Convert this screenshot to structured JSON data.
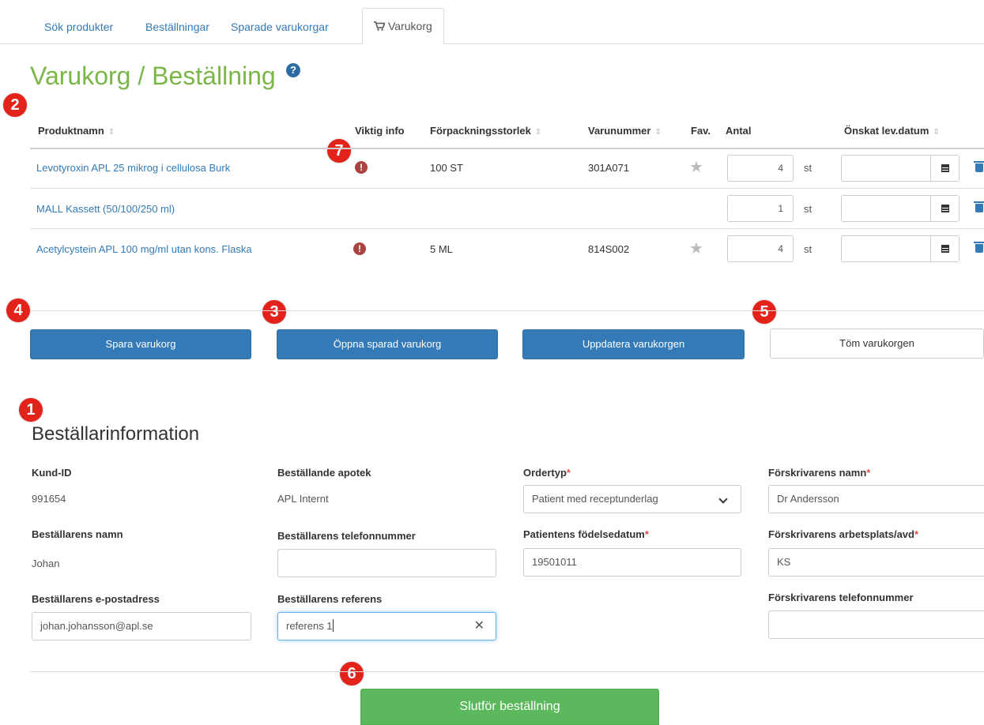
{
  "tabs": [
    {
      "label": "Sök produkter"
    },
    {
      "label": "Beställningar"
    },
    {
      "label": "Sparade varukorgar"
    },
    {
      "label": "Varukorg",
      "icon": "cart-icon",
      "active": true
    }
  ],
  "page": {
    "title": "Varukorg / Beställning",
    "help_icon": "question-circle-icon"
  },
  "annotations": [
    "1",
    "2",
    "3",
    "4",
    "5",
    "6",
    "7"
  ],
  "colors": {
    "brand_green": "#7ab648",
    "primary": "#337ab7",
    "success": "#5cb85c",
    "badge_red": "#e3221a",
    "warning": "#a94442"
  },
  "cart": {
    "columns": {
      "product": "Produktnamn",
      "info": "Viktig info",
      "pack": "Förpackningsstorlek",
      "article": "Varunummer",
      "fav": "Fav.",
      "qty": "Antal",
      "date": "Önskat lev.datum"
    },
    "sort_icon": "sort-icon",
    "rows": [
      {
        "name": "Levotyroxin APL 25 mikrog i cellulosa Burk",
        "info": "exclamation-circle-icon",
        "pack": "100 ST",
        "article": "301A071",
        "fav": "star-icon",
        "qty": "4",
        "unit": "st",
        "date": ""
      },
      {
        "name": "MALL Kassett (50/100/250 ml)",
        "info": "",
        "pack": "",
        "article": "",
        "fav": "",
        "qty": "1",
        "unit": "st",
        "date": ""
      },
      {
        "name": "Acetylcystein APL 100 mg/ml utan kons. Flaska",
        "info": "exclamation-circle-icon",
        "pack": "5 ML",
        "article": "814S002",
        "fav": "star-icon",
        "qty": "4",
        "unit": "st",
        "date": ""
      }
    ]
  },
  "actions": {
    "save": "Spara varukorg",
    "open": "Öppna sparad varukorg",
    "update": "Uppdatera varukorgen",
    "empty": "Töm varukorgen"
  },
  "orderer": {
    "title": "Beställarinformation",
    "customer_id_label": "Kund-ID",
    "customer_id": "991654",
    "pharmacy_label": "Beställande apotek",
    "pharmacy": "APL Internt",
    "order_type_label": "Ordertyp",
    "order_type": "Patient med receptunderlag",
    "prescriber_name_label": "Förskrivarens namn",
    "prescriber_name": "Dr Andersson",
    "orderer_name_label": "Beställarens namn",
    "orderer_name": "Johan",
    "orderer_phone_label": "Beställarens telefonnummer",
    "orderer_phone": "",
    "birthdate_label": "Patientens födelsedatum",
    "birthdate": "19501011",
    "workplace_label": "Förskrivarens arbetsplats/avd",
    "workplace": "KS",
    "email_label": "Beställarens e-postadress",
    "email": "johan.johansson@apl.se",
    "reference_label": "Beställarens referens",
    "reference": "referens 1",
    "prescriber_phone_label": "Förskrivarens telefonnummer",
    "prescriber_phone": "",
    "required_mark": "*"
  },
  "submit": {
    "label": "Slutför beställning"
  }
}
